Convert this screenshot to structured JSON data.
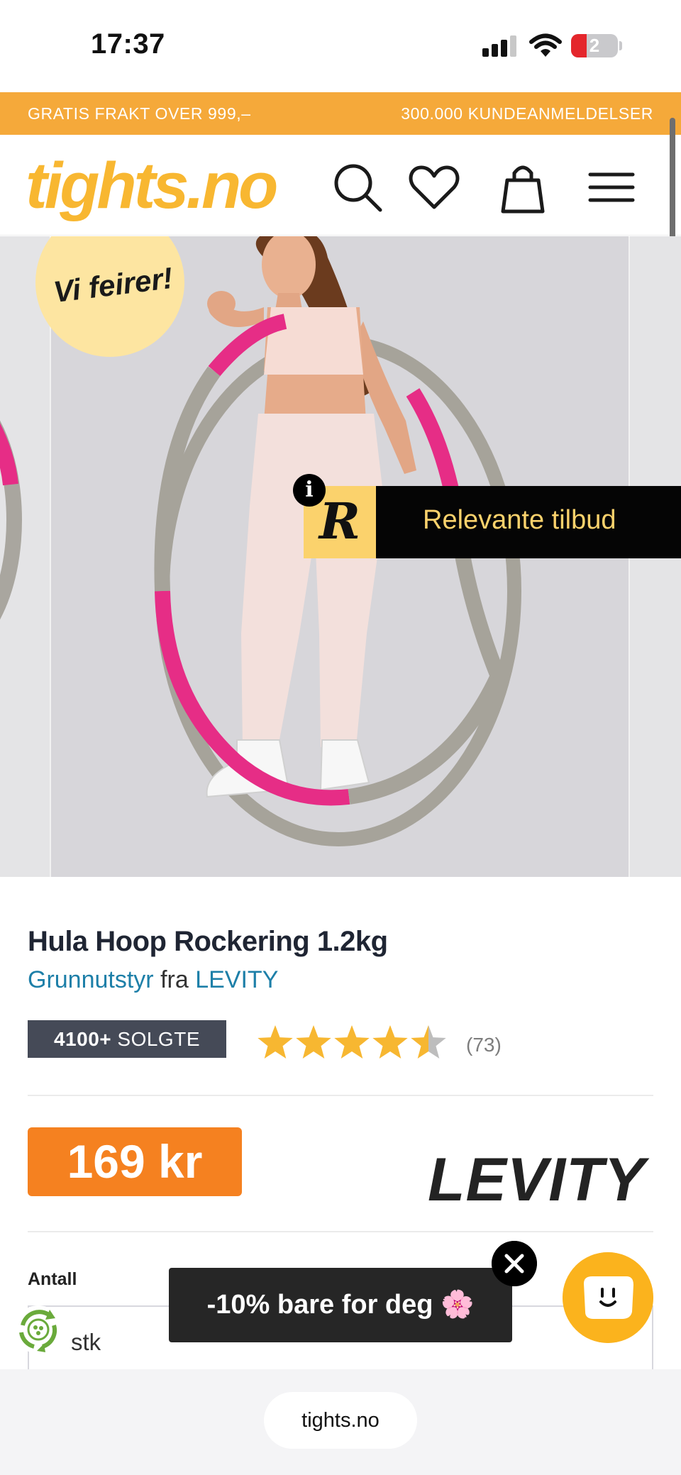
{
  "status_bar": {
    "time": "17:37",
    "battery_level": "2",
    "icons": [
      "signal-icon",
      "wifi-icon",
      "battery-icon"
    ]
  },
  "promo_bar": {
    "left_text": "GRATIS FRAKT OVER 999,–",
    "right_text": "300.000 KUNDEANMELDELSER",
    "color": "#f5a93a"
  },
  "header": {
    "logo": "tights.no",
    "logo_color": "#f8b731",
    "icons": [
      "search-icon",
      "heart-icon",
      "bag-icon",
      "menu-icon"
    ]
  },
  "gallery": {
    "badge_text": "Vi feirer!",
    "overlay": {
      "label": "Relevante tilbud",
      "logo_letter": "R",
      "info_glyph": "i"
    }
  },
  "product": {
    "title": "Hula Hoop Rockering 1.2kg",
    "category_link": "Grunnutstyr",
    "from_word": "fra",
    "brand_link": "LEVITY",
    "sold_count": "4100+",
    "sold_label": "SOLGTE",
    "rating": 4.5,
    "rating_max": 5,
    "review_count": "(73)",
    "price": "169 kr",
    "price_color": "#f58120",
    "brand_logo": "LEVITY"
  },
  "quantity": {
    "label": "Antall",
    "value": "stk"
  },
  "discount_popup": {
    "text": "-10% bare for deg 🌸"
  },
  "browser": {
    "url": "tights.no"
  }
}
